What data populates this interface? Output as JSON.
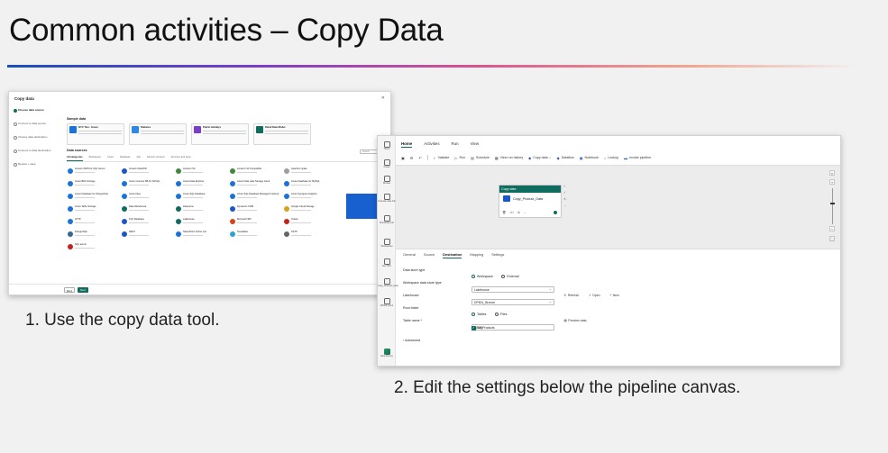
{
  "slide": {
    "title": "Common activities – Copy Data",
    "caption1": "1. Use the copy data tool.",
    "caption2": "2. Edit the settings below the pipeline canvas."
  },
  "copy_tool": {
    "title": "Copy data",
    "close": "✕",
    "nav": [
      "Choose data source",
      "Connect to data source",
      "Choose data destination",
      "Connect to data destination",
      "Review + save"
    ],
    "sample_header": "Sample data",
    "samples": [
      {
        "name": "NYC Taxi - Green",
        "color": "#1a73d9"
      },
      {
        "name": "Diabetes",
        "color": "#2d8ae0"
      },
      {
        "name": "Public Holidays",
        "color": "#7a3fc6"
      },
      {
        "name": "Retail Data Model",
        "color": "#0f6c5e"
      }
    ],
    "sources_header": "Data sources",
    "tabs": [
      "All categories",
      "Workspace",
      "Azure",
      "Database",
      "File",
      "Generic protocol",
      "Services and apps"
    ],
    "search_placeholder": "Search",
    "sources": [
      {
        "name": "Amazon RDS for SQL Server",
        "color": "#1a73d9"
      },
      {
        "name": "Amazon Redshift",
        "color": "#1a57c8"
      },
      {
        "name": "Amazon S3",
        "color": "#3d8a3a"
      },
      {
        "name": "Amazon S3 Compatible",
        "color": "#3d8a3a"
      },
      {
        "name": "Apache Impala",
        "color": "#9e9e9e"
      },
      {
        "name": "Azure Blob Storage",
        "color": "#1a73d9"
      },
      {
        "name": "Azure Cosmos DB for NoSQL",
        "color": "#1a73d9"
      },
      {
        "name": "Azure Data Explorer",
        "color": "#1a73d9"
      },
      {
        "name": "Azure Data Lake Storage Gen2",
        "color": "#1a73d9"
      },
      {
        "name": "Azure Database for MySQL",
        "color": "#1a73d9"
      },
      {
        "name": "Azure Database for PostgreSQL",
        "color": "#1a73d9"
      },
      {
        "name": "Azure Files",
        "color": "#1a73d9"
      },
      {
        "name": "Azure SQL Database",
        "color": "#1a73d9"
      },
      {
        "name": "Azure SQL Database Managed Instance",
        "color": "#1a73d9"
      },
      {
        "name": "Azure Synapse Analytics",
        "color": "#1a73d9"
      },
      {
        "name": "Azure Table Storage",
        "color": "#1a73d9"
      },
      {
        "name": "Data Warehouse",
        "color": "#0f6c5e"
      },
      {
        "name": "Dataverse",
        "color": "#0f6c5e"
      },
      {
        "name": "Dynamics CRM",
        "color": "#1a57c8"
      },
      {
        "name": "Google Cloud Storage",
        "color": "#d8a21a"
      },
      {
        "name": "HTTP",
        "color": "#1a73d9"
      },
      {
        "name": "KQL Database",
        "color": "#1a57c8"
      },
      {
        "name": "Lakehouse",
        "color": "#0f6c5e"
      },
      {
        "name": "Microsoft 365",
        "color": "#d9421a"
      },
      {
        "name": "Oracle",
        "color": "#c8211a"
      },
      {
        "name": "PostgreSQL",
        "color": "#33669a"
      },
      {
        "name": "REST",
        "color": "#1a57c8"
      },
      {
        "name": "SharePoint Online List",
        "color": "#1a73d9"
      },
      {
        "name": "Snowflake",
        "color": "#2aa3d8"
      },
      {
        "name": "SFTP",
        "color": "#666666"
      },
      {
        "name": "SQL server",
        "color": "#c8211a"
      }
    ],
    "back_label": "Back",
    "next_label": "Next"
  },
  "pipeline": {
    "rail": [
      "Home",
      "Create",
      "Browse",
      "OneLake data hub",
      "Monitoring hub",
      "Workspaces",
      "Dev SKU",
      "Copy_Products_Data",
      "DP600_Work",
      "Data Factory"
    ],
    "menu": [
      "Home",
      "Activities",
      "Run",
      "View"
    ],
    "toolbar": [
      {
        "icon": "✓",
        "label": "Validate"
      },
      {
        "icon": "▷",
        "label": "Run"
      },
      {
        "icon": "▤",
        "label": "Schedule"
      },
      {
        "icon": "▦",
        "label": "View run history"
      },
      {
        "icon": "◆",
        "label": "Copy data ⌄"
      },
      {
        "icon": "◆",
        "label": "Dataflow"
      },
      {
        "icon": "▣",
        "label": "Notebook"
      },
      {
        "icon": "○",
        "label": "Lookup"
      },
      {
        "icon": "▬",
        "label": "Invoke pipeline"
      }
    ],
    "activity": {
      "header": "Copy data",
      "name": "Copy_Product_Data"
    },
    "tabs": [
      "General",
      "Source",
      "Destination",
      "Mapping",
      "Settings"
    ],
    "form": {
      "store_type_label": "Data store type",
      "store_type_options": [
        "Workspace",
        "External"
      ],
      "ws_type_label": "Workspace data store type",
      "ws_type_value": "Lakehouse",
      "lakehouse_label": "Lakehouse",
      "lakehouse_value": "DP601_Bronze",
      "refresh": "Refresh",
      "open": "Open",
      "new": "New",
      "root_label": "Root folder",
      "root_options": [
        "Tables",
        "Files"
      ],
      "table_label": "Table name *",
      "table_value": "WWI_Products",
      "preview": "Preview data",
      "edit": "Edit",
      "advanced": "Advanced"
    }
  }
}
